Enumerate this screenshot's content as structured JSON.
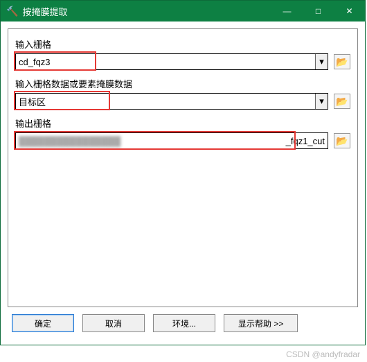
{
  "window": {
    "title": "按掩膜提取"
  },
  "titlebar": {
    "minimize": "—",
    "maximize": "□",
    "close": "✕"
  },
  "fields": {
    "input_raster": {
      "label": "输入栅格",
      "value": "cd_fqz3"
    },
    "mask_data": {
      "label": "输入栅格数据或要素掩膜数据",
      "value": "目标区"
    },
    "output_raster": {
      "label": "输出栅格",
      "suffix": "_fqz1_cut"
    }
  },
  "icons": {
    "browse": "📂",
    "hammer": "🔨",
    "arrow_down": "▾"
  },
  "buttons": {
    "ok": "确定",
    "cancel": "取消",
    "environments": "环境...",
    "show_help": "显示帮助 >>"
  },
  "watermark": "CSDN @andyfradar"
}
